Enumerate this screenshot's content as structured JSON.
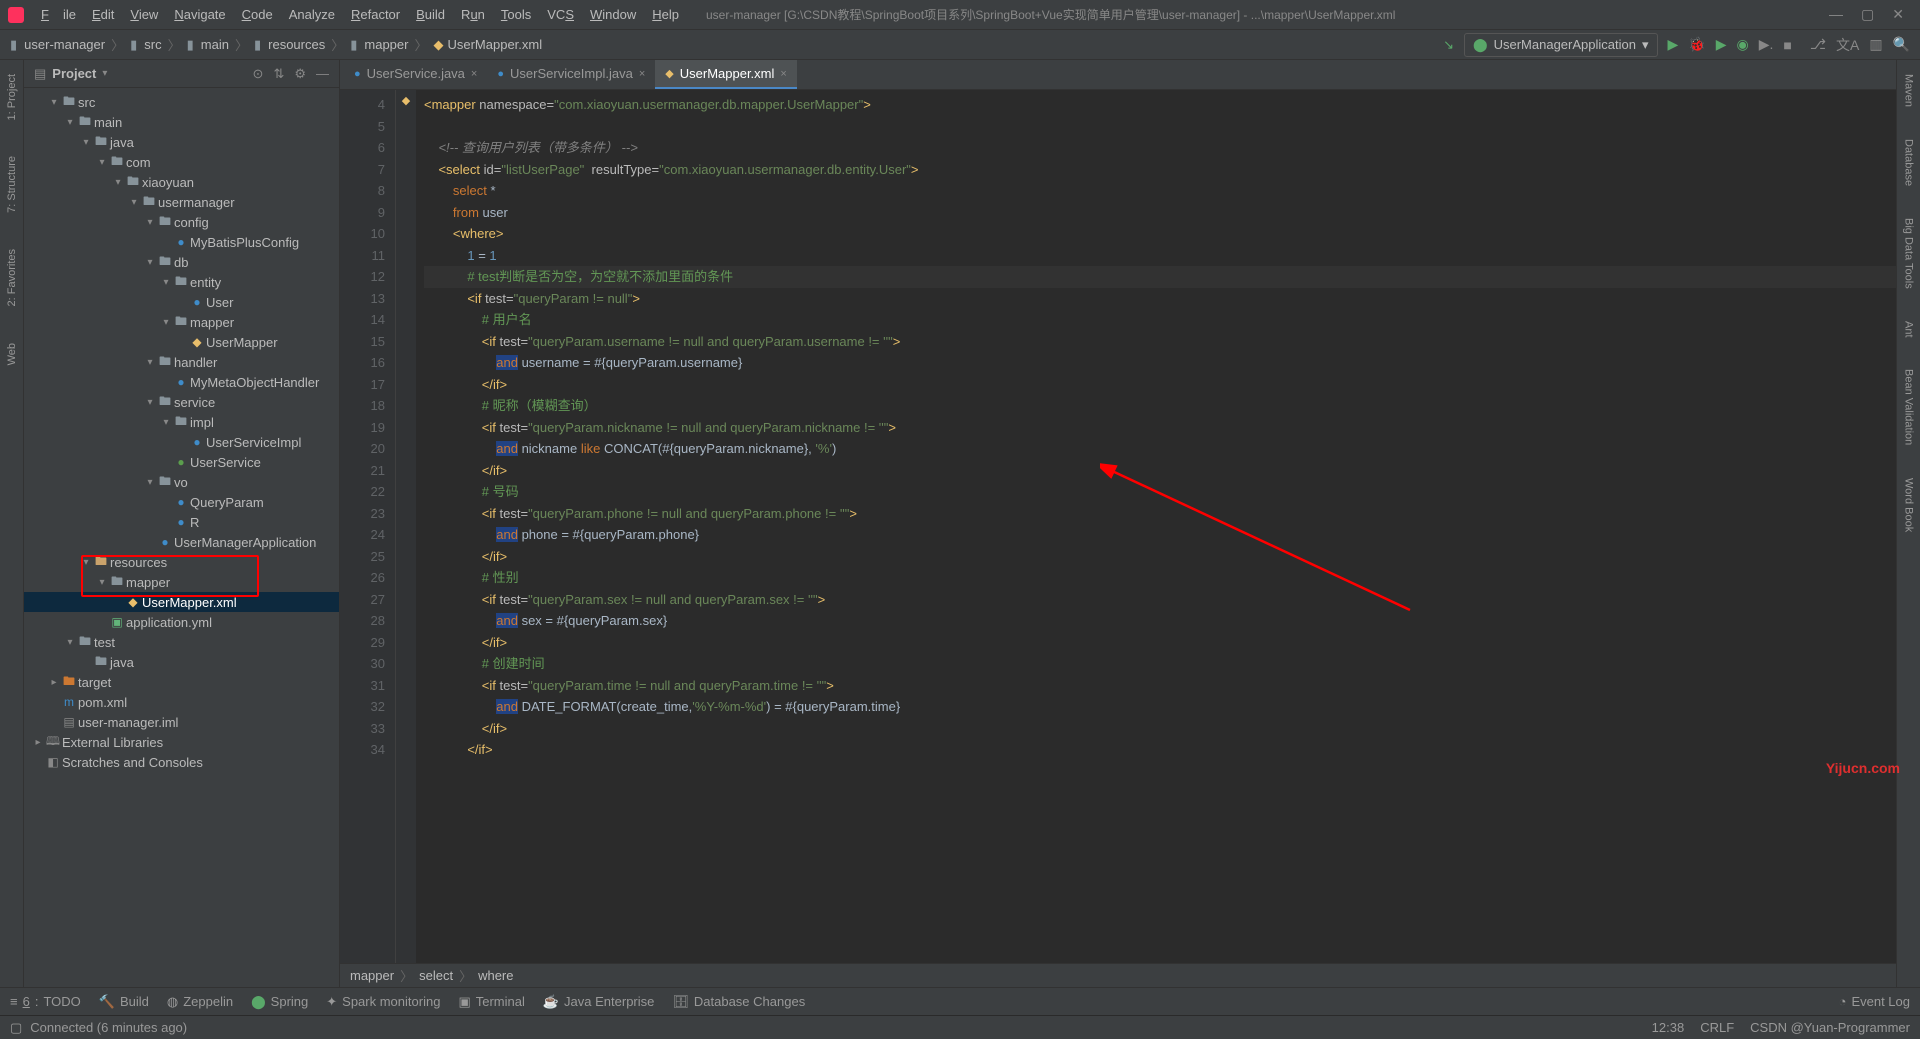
{
  "app": {
    "title_path": "user-manager [G:\\CSDN教程\\SpringBoot项目系列\\SpringBoot+Vue实现简单用户管理\\user-manager] - ...\\mapper\\UserMapper.xml"
  },
  "menu": {
    "file": "File",
    "edit": "Edit",
    "view": "View",
    "navigate": "Navigate",
    "code": "Code",
    "analyze": "Analyze",
    "refactor": "Refactor",
    "build": "Build",
    "run": "Run",
    "tools": "Tools",
    "vcs": "VCS",
    "window": "Window",
    "help": "Help"
  },
  "breadcrumb": {
    "root": "user-manager",
    "src": "src",
    "main": "main",
    "resources": "resources",
    "mapper": "mapper",
    "file": "UserMapper.xml"
  },
  "run_config": {
    "name": "UserManagerApplication"
  },
  "project": {
    "panel_title": "Project",
    "tree": [
      {
        "d": 1,
        "a": "▾",
        "i": "folder",
        "t": "src"
      },
      {
        "d": 2,
        "a": "▾",
        "i": "folder",
        "t": "main"
      },
      {
        "d": 3,
        "a": "▾",
        "i": "folder",
        "t": "java"
      },
      {
        "d": 4,
        "a": "▾",
        "i": "pkg",
        "t": "com"
      },
      {
        "d": 5,
        "a": "▾",
        "i": "pkg",
        "t": "xiaoyuan"
      },
      {
        "d": 6,
        "a": "▾",
        "i": "pkg",
        "t": "usermanager"
      },
      {
        "d": 7,
        "a": "▾",
        "i": "pkg",
        "t": "config"
      },
      {
        "d": 8,
        "a": "",
        "i": "java",
        "t": "MyBatisPlusConfig"
      },
      {
        "d": 7,
        "a": "▾",
        "i": "pkg",
        "t": "db"
      },
      {
        "d": 8,
        "a": "▾",
        "i": "pkg",
        "t": "entity"
      },
      {
        "d": 9,
        "a": "",
        "i": "java",
        "t": "User"
      },
      {
        "d": 8,
        "a": "▾",
        "i": "pkg",
        "t": "mapper"
      },
      {
        "d": 9,
        "a": "",
        "i": "xml",
        "t": "UserMapper"
      },
      {
        "d": 7,
        "a": "▾",
        "i": "pkg",
        "t": "handler"
      },
      {
        "d": 8,
        "a": "",
        "i": "java",
        "t": "MyMetaObjectHandler"
      },
      {
        "d": 7,
        "a": "▾",
        "i": "pkg",
        "t": "service"
      },
      {
        "d": 8,
        "a": "▾",
        "i": "pkg",
        "t": "impl"
      },
      {
        "d": 9,
        "a": "",
        "i": "java",
        "t": "UserServiceImpl"
      },
      {
        "d": 8,
        "a": "",
        "i": "int",
        "t": "UserService"
      },
      {
        "d": 7,
        "a": "▾",
        "i": "pkg",
        "t": "vo"
      },
      {
        "d": 8,
        "a": "",
        "i": "java",
        "t": "QueryParam"
      },
      {
        "d": 8,
        "a": "",
        "i": "java",
        "t": "R"
      },
      {
        "d": 7,
        "a": "",
        "i": "java",
        "t": "UserManagerApplication"
      },
      {
        "d": 3,
        "a": "▾",
        "i": "res",
        "t": "resources"
      },
      {
        "d": 4,
        "a": "▾",
        "i": "pkg",
        "t": "mapper"
      },
      {
        "d": 5,
        "a": "",
        "i": "xml",
        "t": "UserMapper.xml",
        "sel": true
      },
      {
        "d": 4,
        "a": "",
        "i": "yml",
        "t": "application.yml"
      },
      {
        "d": 2,
        "a": "▾",
        "i": "folder",
        "t": "test"
      },
      {
        "d": 3,
        "a": "",
        "i": "folder",
        "t": "java"
      },
      {
        "d": 1,
        "a": "▸",
        "i": "target",
        "t": "target"
      },
      {
        "d": 1,
        "a": "",
        "i": "mvn",
        "t": "pom.xml"
      },
      {
        "d": 1,
        "a": "",
        "i": "file",
        "t": "user-manager.iml"
      },
      {
        "d": 0,
        "a": "▸",
        "i": "lib",
        "t": "External Libraries"
      },
      {
        "d": 0,
        "a": "",
        "i": "scratch",
        "t": "Scratches and Consoles"
      }
    ]
  },
  "tabs": [
    {
      "icon": "●",
      "iconClass": "java-icon",
      "label": "UserService.java",
      "active": false
    },
    {
      "icon": "●",
      "iconClass": "java-icon",
      "label": "UserServiceImpl.java",
      "active": false
    },
    {
      "icon": "◆",
      "iconClass": "xml-icon",
      "label": "UserMapper.xml",
      "active": true
    }
  ],
  "gutter_start": 4,
  "gutter_end": 34,
  "code_lines": [
    "<span class='tag'>&lt;mapper</span> <span class='attr'>namespace=</span><span class='str'>\"com.xiaoyuan.usermanager.db.mapper.UserMapper\"</span><span class='tag'>&gt;</span>",
    "",
    "    <span class='cmt'>&lt;!-- 查询用户列表（带多条件） --&gt;</span>",
    "    <span class='tag'>&lt;select</span> <span class='attr'>id=</span><span class='str'>\"listUserPage\"</span>  <span class='attr'>resultType=</span><span class='str'>\"com.xiaoyuan.usermanager.db.entity.User\"</span><span class='tag'>&gt;</span>",
    "        <span class='kw'>select</span> *",
    "        <span class='kw'>from</span> user",
    "        <span class='tag'>&lt;where&gt;</span>",
    "            <span class='num'>1</span> = <span class='num'>1</span>",
    "            <span class='cmt-zh'># test判断是否为空，为空就不添加里面的条件</span>",
    "            <span class='tag'>&lt;if</span> <span class='attr'>test=</span><span class='str'>\"queryParam != null\"</span><span class='tag'>&gt;</span>",
    "                <span class='cmt-zh'># 用户名</span>",
    "                <span class='tag'>&lt;if</span> <span class='attr'>test=</span><span class='str'>\"queryParam.username != null and queryParam.username != ''\"</span><span class='tag'>&gt;</span>",
    "                    <span class='kw hl-and'>and</span> username = #{queryParam.username}",
    "                <span class='tag'>&lt;/if&gt;</span>",
    "                <span class='cmt-zh'># 昵称（模糊查询）</span>",
    "                <span class='tag'>&lt;if</span> <span class='attr'>test=</span><span class='str'>\"queryParam.nickname != null and queryParam.nickname != ''\"</span><span class='tag'>&gt;</span>",
    "                    <span class='kw hl-and'>and</span> nickname <span class='kw'>like</span> CONCAT(#{queryParam.nickname}, <span class='str'>'%'</span>)",
    "                <span class='tag'>&lt;/if&gt;</span>",
    "                <span class='cmt-zh'># 号码</span>",
    "                <span class='tag'>&lt;if</span> <span class='attr'>test=</span><span class='str'>\"queryParam.phone != null and queryParam.phone != ''\"</span><span class='tag'>&gt;</span>",
    "                    <span class='kw hl-and'>and</span> phone = #{queryParam.phone}",
    "                <span class='tag'>&lt;/if&gt;</span>",
    "                <span class='cmt-zh'># 性别</span>",
    "                <span class='tag'>&lt;if</span> <span class='attr'>test=</span><span class='str'>\"queryParam.sex != null and queryParam.sex != ''\"</span><span class='tag'>&gt;</span>",
    "                    <span class='kw hl-and'>and</span> sex = #{queryParam.sex}",
    "                <span class='tag'>&lt;/if&gt;</span>",
    "                <span class='cmt-zh'># 创建时间</span>",
    "                <span class='tag'>&lt;if</span> <span class='attr'>test=</span><span class='str'>\"queryParam.time != null and queryParam.time != ''\"</span><span class='tag'>&gt;</span>",
    "                    <span class='kw hl-and'>and</span> DATE_FORMAT(create_time,<span class='str'>'%Y-%m-%d'</span>) = #{queryParam.time}",
    "                <span class='tag'>&lt;/if&gt;</span>",
    "            <span class='tag'>&lt;/if&gt;</span>"
  ],
  "nav_trail": {
    "l1": "mapper",
    "l2": "select",
    "l3": "where"
  },
  "bottom": {
    "todo": "TODO",
    "build": "Build",
    "zeppelin": "Zeppelin",
    "spring": "Spring",
    "spark": "Spark monitoring",
    "terminal": "Terminal",
    "javaee": "Java Enterprise",
    "db": "Database Changes",
    "eventlog": "Event Log"
  },
  "status": {
    "connected": "Connected (6 minutes ago)",
    "time": "12:38",
    "crlf": "CRLF",
    "csdn": "CSDN @Yuan-Programmer"
  },
  "side_left": [
    "1: Project",
    "7: Structure",
    "2: Favorites",
    "Web"
  ],
  "side_right": [
    "Maven",
    "Database",
    "Big Data Tools",
    "Ant",
    "Bean Validation",
    "Word Book"
  ],
  "watermark": "Yijucn.com"
}
